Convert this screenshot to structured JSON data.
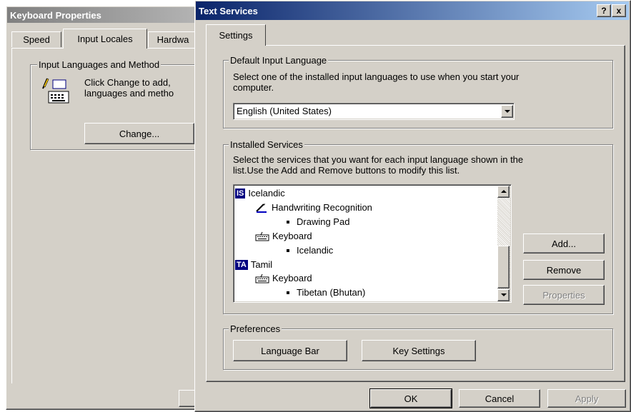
{
  "keyboard_dialog": {
    "title": "Keyboard Properties",
    "tabs": [
      {
        "label": "Speed"
      },
      {
        "label": "Input Locales"
      },
      {
        "label": "Hardwa"
      }
    ],
    "group_title": "Input Languages and Method",
    "description_line1": "Click Change to add,",
    "description_line2": "languages and metho",
    "change_button": "Change..."
  },
  "text_services": {
    "title": "Text Services",
    "title_buttons": {
      "help": "?",
      "close": "x"
    },
    "tab": "Settings",
    "default_language": {
      "group_title": "Default Input Language",
      "description_line1": "Select one of the installed input languages to use when you start your",
      "description_line2": "computer.",
      "selected": "English (United States)"
    },
    "installed_services": {
      "group_title": "Installed Services",
      "description_line1": "Select the services that you want for each input language shown in the",
      "description_line2": "list.Use the Add and Remove buttons to modify this list.",
      "tree": [
        {
          "level": 0,
          "badge": "IS",
          "label": "Icelandic"
        },
        {
          "level": 1,
          "icon": "pen-icon",
          "label": "Handwriting Recognition"
        },
        {
          "level": 2,
          "label": "Drawing Pad"
        },
        {
          "level": 1,
          "icon": "keyboard-icon",
          "label": "Keyboard"
        },
        {
          "level": 2,
          "label": "Icelandic"
        },
        {
          "level": 0,
          "badge": "TA",
          "label": "Tamil"
        },
        {
          "level": 1,
          "icon": "keyboard-icon",
          "label": "Keyboard"
        },
        {
          "level": 2,
          "label": "Tibetan (Bhutan)"
        }
      ],
      "add_button": "Add...",
      "remove_button": "Remove",
      "properties_button": "Properties"
    },
    "preferences": {
      "group_title": "Preferences",
      "language_bar_button": "Language Bar",
      "key_settings_button": "Key Settings"
    },
    "ok_button": "OK",
    "cancel_button": "Cancel",
    "apply_button": "Apply"
  },
  "colors": {
    "dialog_face": "#d4d0c8",
    "title_active": "#0a246a",
    "title_inactive": "#808080",
    "badge": "#000080"
  }
}
